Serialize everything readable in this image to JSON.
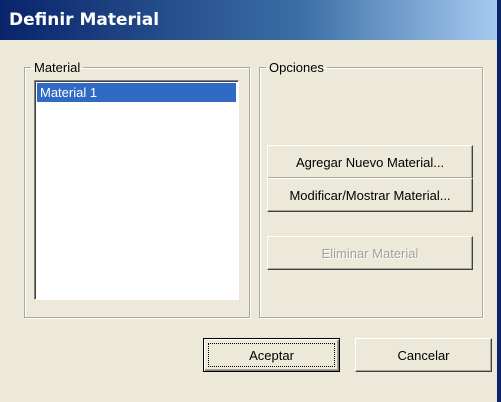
{
  "window": {
    "title": "Definir Material"
  },
  "material_group": {
    "legend": "Material",
    "items": [
      {
        "label": "Material 1",
        "selected": true
      }
    ]
  },
  "options_group": {
    "legend": "Opciones",
    "buttons": {
      "add_label": "Agregar Nuevo Material...",
      "modify_label": "Modificar/Mostrar Material...",
      "delete_label": "Eliminar Material"
    }
  },
  "footer": {
    "ok_label": "Aceptar",
    "cancel_label": "Cancelar"
  },
  "colors": {
    "titlebar_start": "#0a246a",
    "titlebar_end": "#a6caf0",
    "selection": "#316ac5",
    "dialog_face": "#ece9d8"
  }
}
